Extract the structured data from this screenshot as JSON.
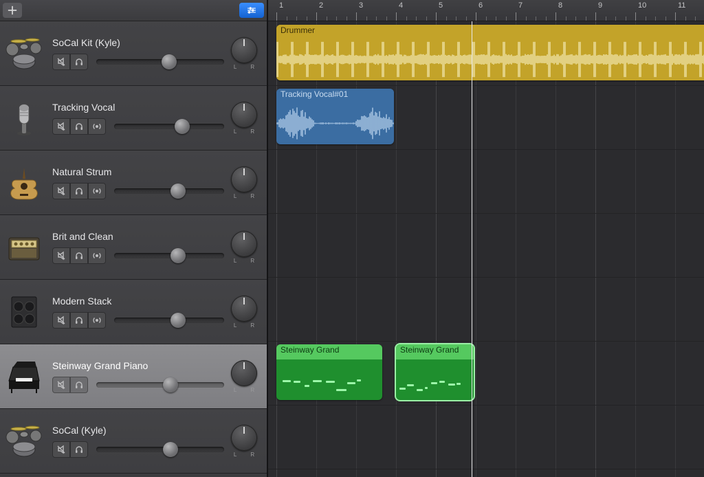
{
  "header": {
    "add_label": "Add Track",
    "filter_label": "Filter"
  },
  "ruler": {
    "bars": [
      "1",
      "2",
      "3",
      "4",
      "5",
      "6",
      "7",
      "8",
      "9",
      "10",
      "11"
    ]
  },
  "playhead": {
    "bar": 5.9
  },
  "knob": {
    "L": "L",
    "R": "R"
  },
  "tracks": [
    {
      "name": "SoCal Kit (Kyle)",
      "icon": "drums",
      "buttons": [
        "mute",
        "solo"
      ],
      "vol": 0.57,
      "selected": false
    },
    {
      "name": "Tracking Vocal",
      "icon": "mic",
      "buttons": [
        "mute",
        "solo",
        "input"
      ],
      "vol": 0.62,
      "selected": false
    },
    {
      "name": "Natural Strum",
      "icon": "acoustic",
      "buttons": [
        "mute",
        "solo",
        "input"
      ],
      "vol": 0.58,
      "selected": false
    },
    {
      "name": "Brit and Clean",
      "icon": "amp",
      "buttons": [
        "mute",
        "solo",
        "input"
      ],
      "vol": 0.58,
      "selected": false
    },
    {
      "name": "Modern Stack",
      "icon": "cab",
      "buttons": [
        "mute",
        "solo",
        "input"
      ],
      "vol": 0.58,
      "selected": false
    },
    {
      "name": "Steinway Grand Piano",
      "icon": "piano",
      "buttons": [
        "mute",
        "solo"
      ],
      "vol": 0.58,
      "selected": true
    },
    {
      "name": "SoCal (Kyle)",
      "icon": "drums",
      "buttons": [
        "mute",
        "solo"
      ],
      "vol": 0.58,
      "selected": false
    }
  ],
  "regions": [
    {
      "label": "Drummer",
      "track": 0,
      "start": 1,
      "end": 12,
      "color": "yellow",
      "kind": "audio"
    },
    {
      "label": "Tracking Vocal#01",
      "track": 1,
      "start": 1,
      "end": 3.95,
      "color": "blue",
      "kind": "audio"
    },
    {
      "label": "Steinway Grand",
      "track": 5,
      "start": 1,
      "end": 3.65,
      "color": "green",
      "kind": "midi",
      "selected": false
    },
    {
      "label": "Steinway Grand",
      "track": 5,
      "start": 4,
      "end": 5.95,
      "color": "green",
      "kind": "midi",
      "selected": true
    }
  ],
  "colors": {
    "yellow": "#c3a329",
    "blue": "#3b6da2",
    "green": "#1f8f2e",
    "accent": "#176bd6"
  }
}
